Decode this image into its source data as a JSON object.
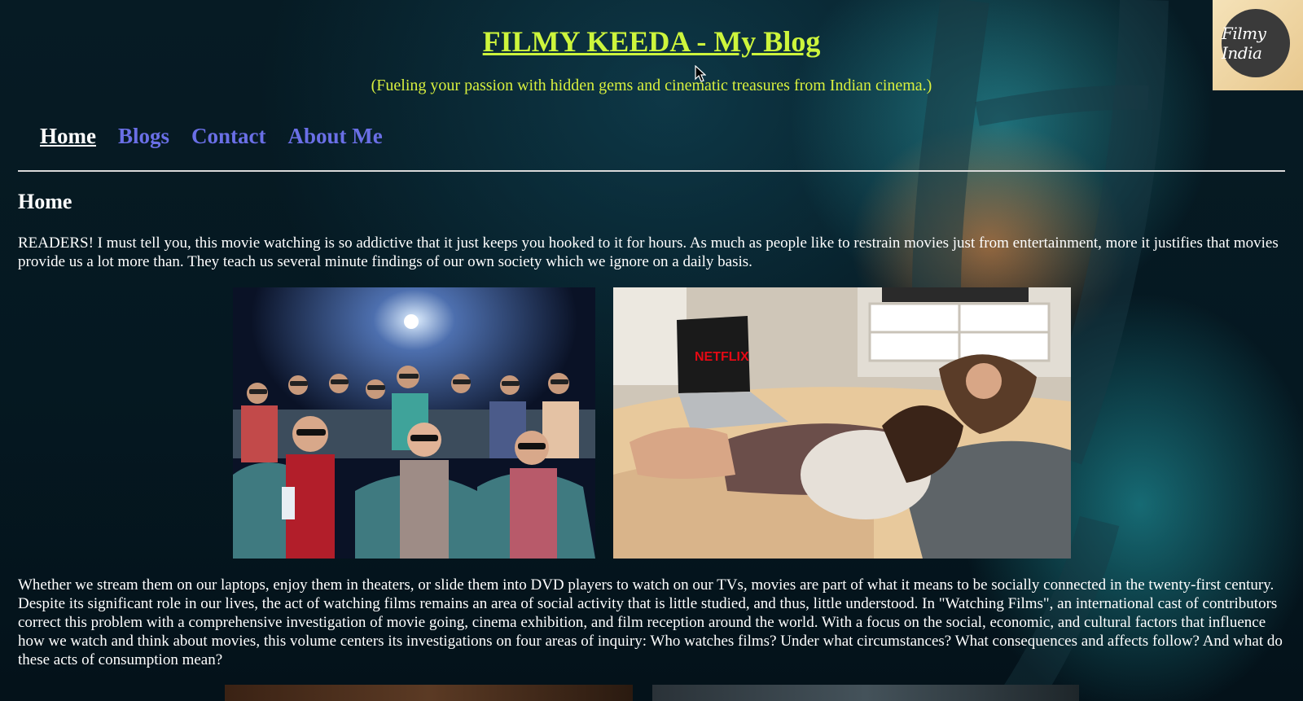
{
  "header": {
    "title": "FILMY KEEDA - My Blog",
    "tagline": "(Fueling your passion with hidden gems and cinematic treasures from Indian cinema.)",
    "logo_text": "Filmy India"
  },
  "nav": {
    "items": [
      {
        "label": "Home",
        "active": true
      },
      {
        "label": "Blogs",
        "active": false
      },
      {
        "label": "Contact",
        "active": false
      },
      {
        "label": "About Me",
        "active": false
      }
    ]
  },
  "content": {
    "heading": "Home",
    "paragraph1": "READERS! I must tell you, this movie watching is so addictive that it just keeps you hooked to it for hours. As much as people like to restrain movies just from entertainment, more it justifies that movies provide us a lot more than. They teach us several minute findings of our own society which we ignore on a daily basis.",
    "paragraph2": "Whether we stream them on our laptops, enjoy them in theaters, or slide them into DVD players to watch on our TVs, movies are part of what it means to be socially connected in the twenty-first century. Despite its significant role in our lives, the act of watching films remains an area of social activity that is little studied, and thus, little understood. In \"Watching Films\", an international cast of contributors correct this problem with a comprehensive investigation of movie going, cinema exhibition, and film reception around the world. With a focus on the social, economic, and cultural factors that influence how we watch and think about movies, this volume centers its investigations on four areas of inquiry: Who watches films? Under what circumstances? What consequences and affects follow? And what do these acts of consumption mean?",
    "laptop_brand": "NETFLIX"
  },
  "colors": {
    "title": "#cdf53c",
    "tagline": "#d8f03e",
    "nav_link": "#6a6fe6",
    "nav_active": "#ffffff",
    "background": "#061b24"
  }
}
